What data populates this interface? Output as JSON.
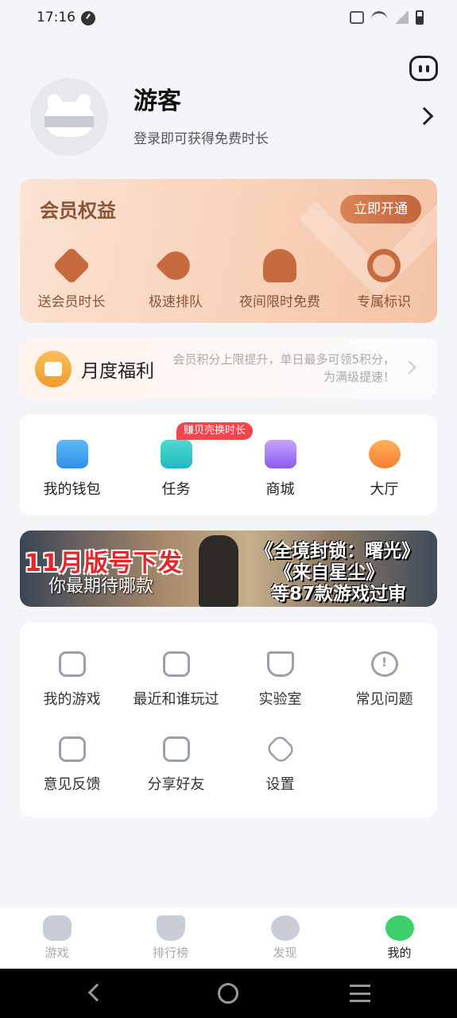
{
  "status_bar": {
    "time": "17:16"
  },
  "profile": {
    "name": "游客",
    "subtitle": "登录即可获得免费时长"
  },
  "vip": {
    "title": "会员权益",
    "open_button": "立即开通",
    "items": [
      {
        "label": "送会员时长",
        "icon": "clock-tag-icon"
      },
      {
        "label": "极速排队",
        "icon": "rocket-icon"
      },
      {
        "label": "夜间限时免费",
        "icon": "moon-cloud-icon"
      },
      {
        "label": "专属标识",
        "icon": "medal-icon"
      }
    ]
  },
  "monthly": {
    "title": "月度福利",
    "description": "会员积分上限提升，单日最多可领5积分，为满级提速！"
  },
  "quick": {
    "badge": "赚贝壳换时长",
    "items": [
      {
        "label": "我的钱包",
        "icon": "wallet-icon",
        "color": "#3aa3f0"
      },
      {
        "label": "任务",
        "icon": "task-icon",
        "color": "#2cc7c4"
      },
      {
        "label": "商城",
        "icon": "shop-icon",
        "color": "#9b6bf0"
      },
      {
        "label": "大厅",
        "icon": "lobby-icon",
        "color": "#f5913a"
      }
    ]
  },
  "banner": {
    "line1": "11月版号下发",
    "line2": "你最期待哪款",
    "line3": "《全境封锁：曙光》",
    "line4": "《来自星尘》",
    "line5": "等87款游戏过审"
  },
  "menu": {
    "items": [
      {
        "label": "我的游戏",
        "icon": "gamepad-icon"
      },
      {
        "label": "最近和谁玩过",
        "icon": "recent-play-icon"
      },
      {
        "label": "实验室",
        "icon": "flask-icon"
      },
      {
        "label": "常见问题",
        "icon": "question-icon"
      },
      {
        "label": "意见反馈",
        "icon": "feedback-icon"
      },
      {
        "label": "分享好友",
        "icon": "share-icon"
      },
      {
        "label": "设置",
        "icon": "settings-icon"
      }
    ]
  },
  "tabs": [
    {
      "label": "游戏",
      "icon": "game-tab-icon"
    },
    {
      "label": "排行榜",
      "icon": "rank-tab-icon"
    },
    {
      "label": "发现",
      "icon": "discover-tab-icon"
    },
    {
      "label": "我的",
      "icon": "mine-tab-icon",
      "active": true
    }
  ]
}
